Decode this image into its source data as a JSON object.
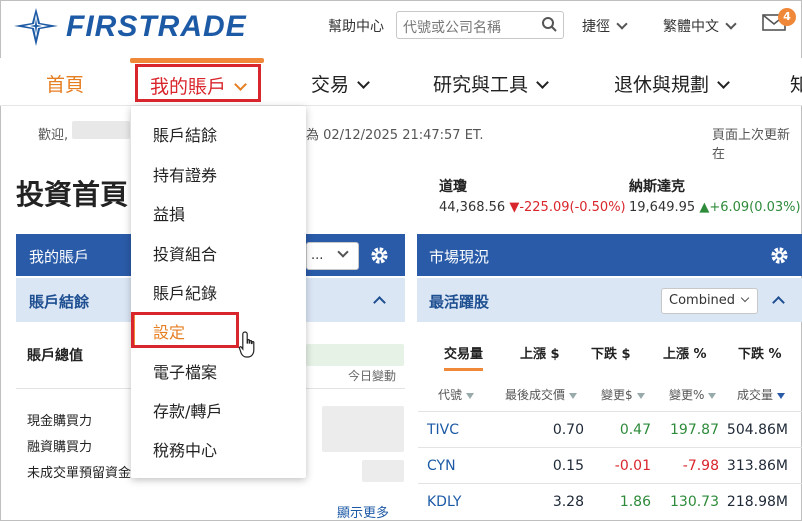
{
  "header": {
    "logo_text": "FIRSTRADE",
    "help": "幫助中心",
    "search_placeholder": "代號或公司名稱",
    "shortcuts": "捷徑",
    "language": "繁體中文",
    "mail_count": "4"
  },
  "nav": {
    "home": "首頁",
    "my_account": "我的賬戶",
    "trade": "交易",
    "research": "研究與工具",
    "retirement": "退休與規劃",
    "more": "知"
  },
  "dropdown": {
    "items": [
      "賬戶結餘",
      "持有證券",
      "益損",
      "投資組合",
      "賬戶紀錄",
      "設定",
      "電子檔案",
      "存款/轉戶",
      "稅務中心"
    ]
  },
  "page": {
    "welcome": "歡迎,",
    "login_time": "為 02/12/2025 21:47:57 ET.",
    "last_update": "頁面上次更新在",
    "title": "投資首頁"
  },
  "indices": [
    {
      "name": "道瓊",
      "value": "44,368.56",
      "arrow": "▼",
      "change": "-225.09(-0.50%)",
      "dir": "neg"
    },
    {
      "name": "納斯達克",
      "value": "19,649.95",
      "arrow": "▲",
      "change": "+6.09(0.03%)",
      "dir": "pos"
    }
  ],
  "account_panel": {
    "title": "我的賬戶",
    "selector": "...",
    "sub_title": "賬戶結餘",
    "total_label": "賬戶總值",
    "today_change": "今日變動",
    "cash_power": "現金購買力",
    "margin_power": "融資購買力",
    "unsettled": "未成交單預留資金",
    "show_more": "顯示更多"
  },
  "market_panel": {
    "title": "市場現況",
    "sub_title": "最活躍股",
    "filter": "Combined",
    "tabs": [
      "交易量",
      "上漲 $",
      "下跌 $",
      "上漲 %",
      "下跌 %"
    ],
    "columns": [
      "代號",
      "最後成交價",
      "變更$",
      "變更%",
      "成交量"
    ],
    "rows": [
      {
        "symbol": "TIVC",
        "last": "0.70",
        "chg": "0.47",
        "pct": "197.87",
        "vol": "504.86M",
        "dir": "pos"
      },
      {
        "symbol": "CYN",
        "last": "0.15",
        "chg": "-0.01",
        "pct": "-7.98",
        "vol": "313.86M",
        "dir": "neg"
      },
      {
        "symbol": "KDLY",
        "last": "3.28",
        "chg": "1.86",
        "pct": "130.73",
        "vol": "218.98M",
        "dir": "pos"
      }
    ]
  },
  "colors": {
    "brand": "#1d5aa6",
    "accent": "#f0883a",
    "highlight": "#d9262c",
    "panel": "#2a5ba8"
  }
}
